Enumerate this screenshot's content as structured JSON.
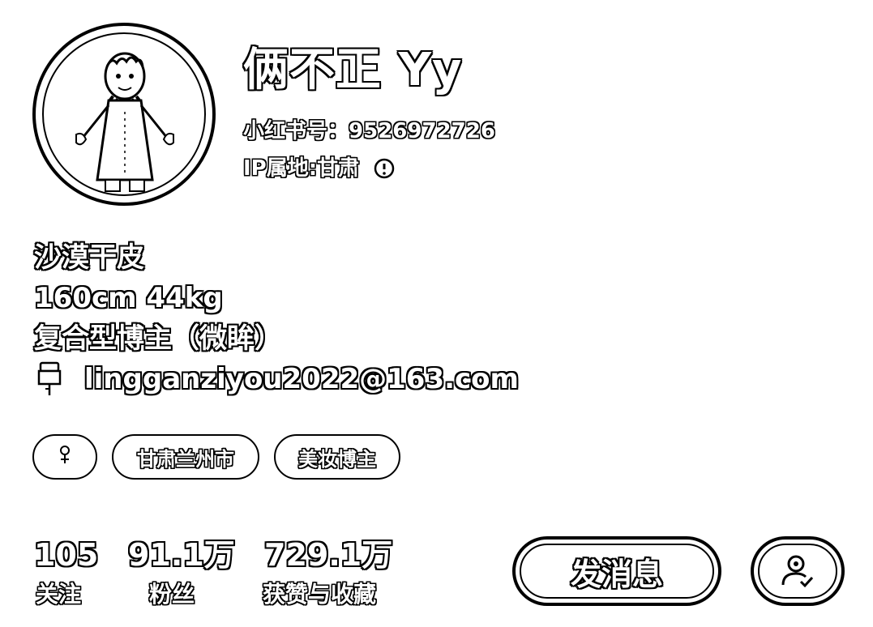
{
  "profile": {
    "name": "俩不正 Yy",
    "red_id_label": "小红书号：",
    "red_id": "9526972726",
    "ip_label": "IP属地: ",
    "ip_location": "甘肃",
    "avatar_icon": "cartoon-avatar",
    "info_icon": "info-circle-icon"
  },
  "bio": {
    "line1": "沙漠干皮",
    "line2": "160cm 44kg",
    "line3": "复合型博主（微眸）",
    "email_icon": "mailbox-icon",
    "email": "lingganziyou2022@163.com"
  },
  "tags": {
    "gender_icon": "female-icon",
    "location": "甘肃兰州市",
    "category": "美妆博主"
  },
  "stats": [
    {
      "value": "105",
      "label": "关注"
    },
    {
      "value": "91.1万",
      "label": "粉丝"
    },
    {
      "value": "729.1万",
      "label": "获赞与收藏"
    }
  ],
  "actions": {
    "message_label": "发消息",
    "follow_icon": "user-check-icon"
  }
}
